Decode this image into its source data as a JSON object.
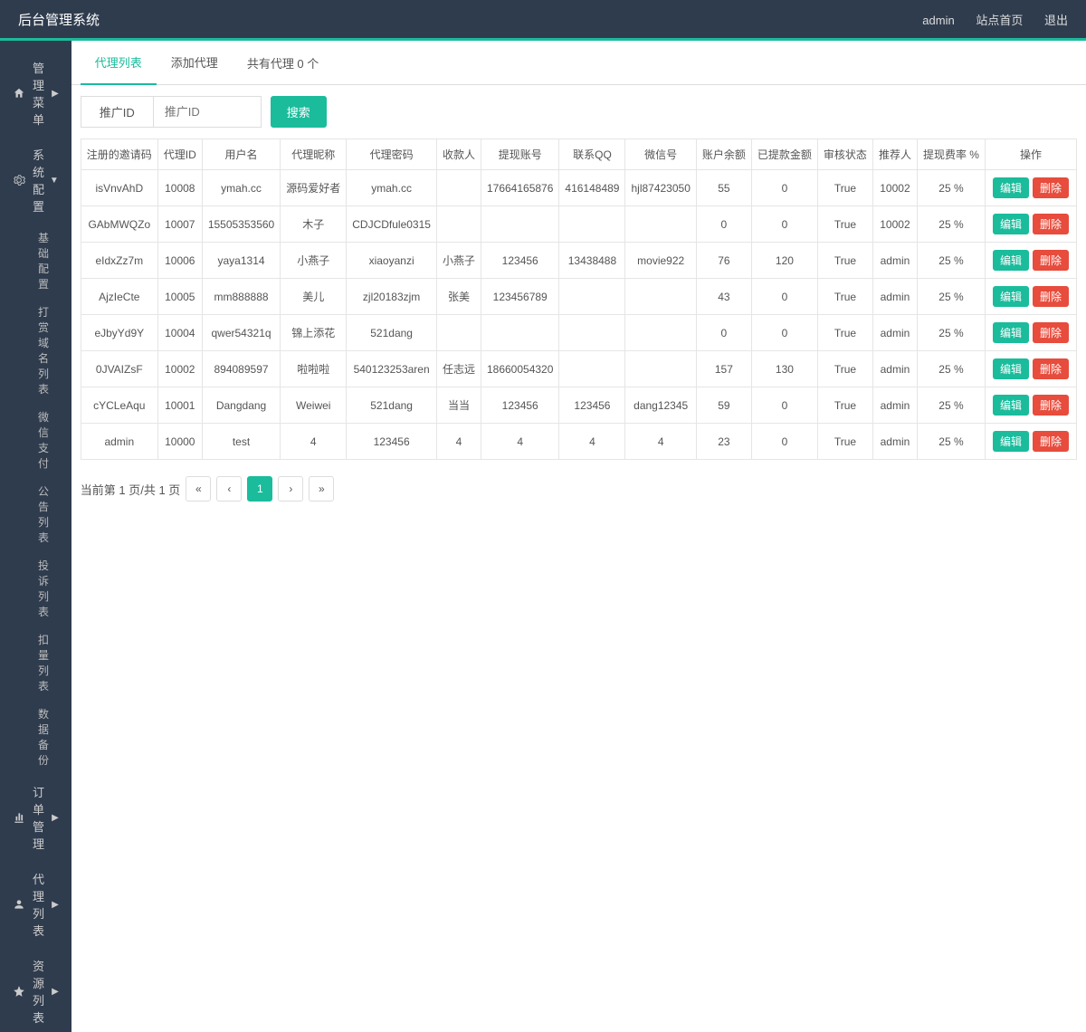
{
  "topbar": {
    "title": "后台管理系统",
    "user": "admin",
    "home": "站点首页",
    "logout": "退出"
  },
  "sidebar": {
    "items": [
      {
        "label": "管理菜单",
        "icon": "home"
      },
      {
        "label": "系统配置",
        "icon": "gear",
        "expanded": true,
        "children": [
          "基础配置",
          "打赏域名列表",
          "微信支付",
          "公告列表",
          "投诉列表",
          "扣量列表",
          "数据备份"
        ]
      },
      {
        "label": "订单管理",
        "icon": "chart"
      },
      {
        "label": "代理列表",
        "icon": "user"
      },
      {
        "label": "资源列表",
        "icon": "star"
      }
    ]
  },
  "tabs": {
    "list": "代理列表",
    "add": "添加代理",
    "total": "共有代理 0 个"
  },
  "search": {
    "label": "推广ID",
    "placeholder": "推广ID",
    "button": "搜索"
  },
  "table": {
    "headers": [
      "注册的邀请码",
      "代理ID",
      "用户名",
      "代理昵称",
      "代理密码",
      "收款人",
      "提现账号",
      "联系QQ",
      "微信号",
      "账户余额",
      "已提款金额",
      "审核状态",
      "推荐人",
      "提现费率 %",
      "操作"
    ],
    "editLabel": "编辑",
    "deleteLabel": "删除",
    "rows": [
      [
        "isVnvAhD",
        "10008",
        "ymah.cc",
        "源码爱好者",
        "ymah.cc",
        "",
        "17664165876",
        "416148489",
        "hjl87423050",
        "55",
        "0",
        "True",
        "10002",
        "25 %"
      ],
      [
        "GAbMWQZo",
        "10007",
        "15505353560",
        "木子",
        "CDJCDfule0315",
        "",
        "",
        "",
        "",
        "0",
        "0",
        "True",
        "10002",
        "25 %"
      ],
      [
        "eIdxZz7m",
        "10006",
        "yaya1314",
        "小燕子",
        "xiaoyanzi",
        "小燕子",
        "123456",
        "13438488",
        "movie922",
        "76",
        "120",
        "True",
        "admin",
        "25 %"
      ],
      [
        "AjzIeCte",
        "10005",
        "mm888888",
        "美儿",
        "zjl20183zjm",
        "张美",
        "123456789",
        "",
        "",
        "43",
        "0",
        "True",
        "admin",
        "25 %"
      ],
      [
        "eJbyYd9Y",
        "10004",
        "qwer54321q",
        "锦上添花",
        "521dang",
        "",
        "",
        "",
        "",
        "0",
        "0",
        "True",
        "admin",
        "25 %"
      ],
      [
        "0JVAIZsF",
        "10002",
        "894089597",
        "啦啦啦",
        "540123253aren",
        "任志远",
        "18660054320",
        "",
        "",
        "157",
        "130",
        "True",
        "admin",
        "25 %"
      ],
      [
        "cYCLeAqu",
        "10001",
        "Dangdang",
        "Weiwei",
        "521dang",
        "当当",
        "123456",
        "123456",
        "dang12345",
        "59",
        "0",
        "True",
        "admin",
        "25 %"
      ],
      [
        "admin",
        "10000",
        "test",
        "4",
        "123456",
        "4",
        "4",
        "4",
        "4",
        "23",
        "0",
        "True",
        "admin",
        "25 %"
      ]
    ]
  },
  "pager": {
    "info": "当前第 1 页/共 1 页",
    "first": "«",
    "prev": "‹",
    "page": "1",
    "next": "›",
    "last": "»"
  }
}
